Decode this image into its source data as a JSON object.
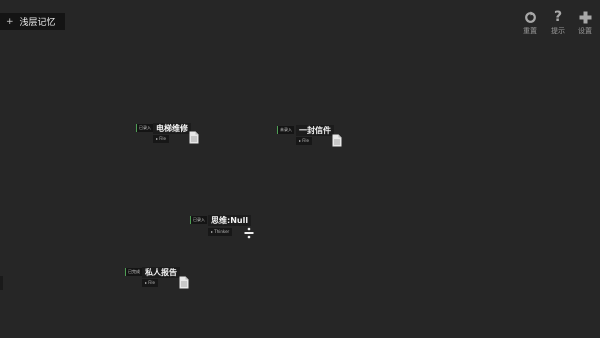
{
  "layer_tag": {
    "icon": "plus-icon",
    "label": "浅层记忆"
  },
  "toolbar": [
    {
      "icon": "reset-icon",
      "label": "重置"
    },
    {
      "icon": "question-icon",
      "label": "提示"
    },
    {
      "icon": "plus-cross-icon",
      "label": "设置"
    }
  ],
  "nodes": [
    {
      "status": "已录入",
      "title": "电梯维修",
      "type": "File",
      "icon": "file-icon"
    },
    {
      "status": "未录入",
      "title": "一封信件",
      "type": "File",
      "icon": "file-icon"
    },
    {
      "status": "已录入",
      "title": "思维:Null",
      "type": "Thinker",
      "icon": "divide-icon"
    },
    {
      "status": "已完成",
      "title": "私人报告",
      "type": "File",
      "icon": "file-icon"
    }
  ]
}
